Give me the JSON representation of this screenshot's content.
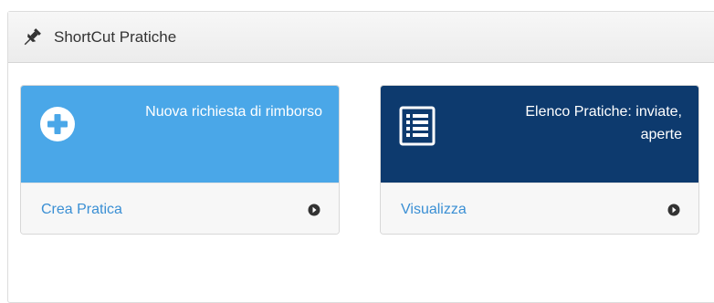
{
  "panel": {
    "title": "ShortCut Pratiche",
    "header_icon": "pin-icon"
  },
  "cards": [
    {
      "heading": "Nuova richiesta di rimborso",
      "icon": "plus-circle-icon",
      "link_label": "Crea Pratica",
      "link_icon": "arrow-circle-right-icon",
      "color": "#4aa7e8"
    },
    {
      "heading": "Elenco Pratiche: inviate, aperte",
      "icon": "list-icon",
      "link_label": "Visualizza",
      "link_icon": "arrow-circle-right-icon",
      "color": "#0d3a6e"
    }
  ],
  "colors": {
    "link": "#3a8fd4",
    "header_bg": "#f0f0f0"
  }
}
